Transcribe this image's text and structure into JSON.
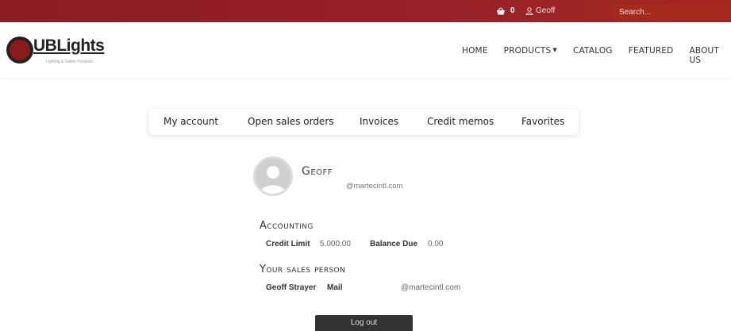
{
  "topbar": {
    "cart_count": "0",
    "user_name": "Geoff",
    "search_placeholder": "Search..."
  },
  "header": {
    "logo_text": "UBLights",
    "logo_tagline": "Lighting & Safety Products",
    "nav": {
      "home": "HOME",
      "products": "PRODUCTS",
      "catalog": "CATALOG",
      "featured": "FEATURED",
      "about": "ABOUT US"
    }
  },
  "tabs": {
    "my_account": "My account",
    "open_orders": "Open sales orders",
    "invoices": "Invoices",
    "credit_memos": "Credit memos",
    "favorites": "Favorites"
  },
  "profile": {
    "name": "Geoff",
    "email": "@martecintl.com"
  },
  "accounting": {
    "title": "Accounting",
    "credit_limit_label": "Credit Limit",
    "credit_limit_value": "5,000.00",
    "balance_due_label": "Balance Due",
    "balance_due_value": "0.00"
  },
  "sales_person": {
    "title": "Your sales person",
    "name": "Geoff Strayer",
    "mail_label": "Mail",
    "mail_value": "@martecintl.com"
  },
  "logout_label": "Log out",
  "colors": {
    "topbar": "#8c1c24",
    "search_bg": "#a52a1b",
    "logo_red": "#8b1a1a",
    "button_dark": "#333333"
  }
}
